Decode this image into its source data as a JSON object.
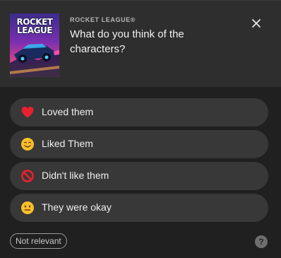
{
  "header": {
    "game_name": "ROCKET LEAGUE®",
    "question": "What do you think of the characters?",
    "art_title_line1": "ROCKET",
    "art_title_line2": "LEAGUE",
    "close_icon": "close-icon"
  },
  "options": [
    {
      "label": "Loved them",
      "icon": "red-heart-icon"
    },
    {
      "label": "Liked Them",
      "icon": "smiling-face-icon"
    },
    {
      "label": "Didn't like them",
      "icon": "prohibited-icon"
    },
    {
      "label": "They were okay",
      "icon": "neutral-face-icon"
    }
  ],
  "footer": {
    "not_relevant_label": "Not relevant",
    "help_label": "?"
  },
  "colors": {
    "header_bg": "#2e2e2e",
    "panel_bg": "#202020",
    "option_bg": "#383838",
    "text_primary": "#f2f2f2",
    "text_secondary": "#b8b8b8"
  }
}
